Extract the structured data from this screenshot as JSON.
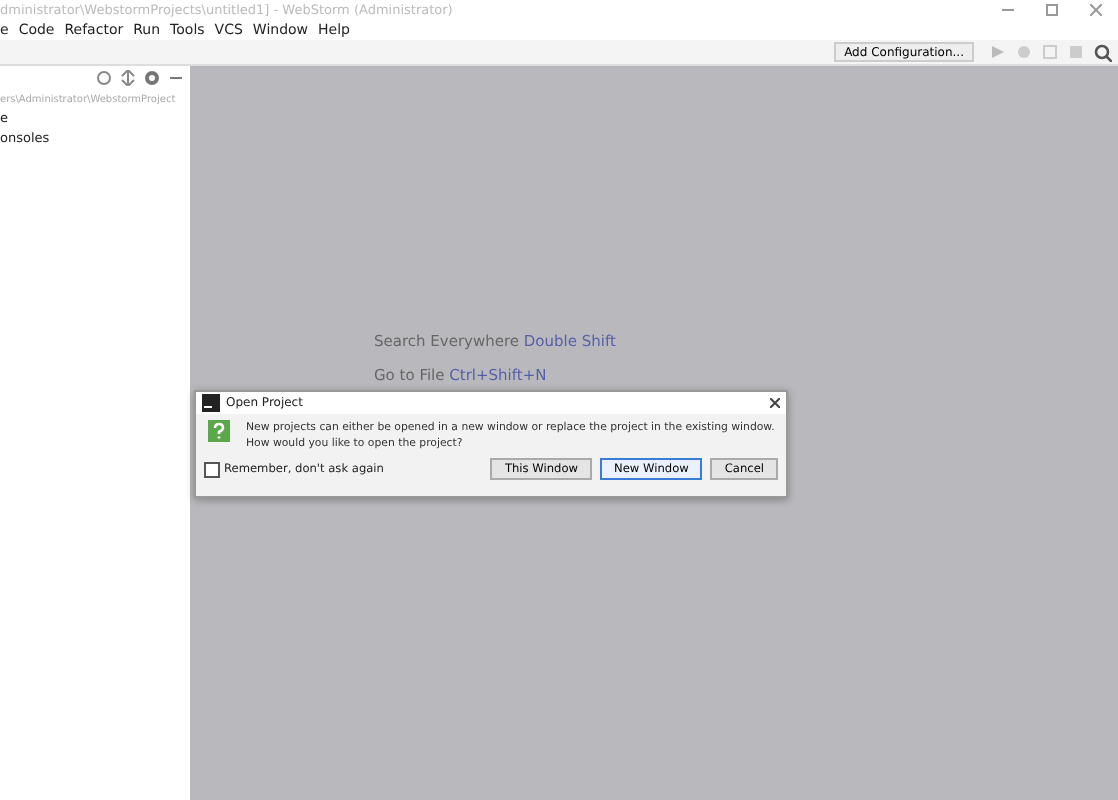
{
  "window": {
    "title": "dministrator\\WebstormProjects\\untitled1] - WebStorm (Administrator)"
  },
  "menu": [
    "e",
    "Code",
    "Refactor",
    "Run",
    "Tools",
    "VCS",
    "Window",
    "Help"
  ],
  "toolbar": {
    "config_button": "Add Configuration..."
  },
  "sidebar": {
    "path": "ers\\Administrator\\WebstormProject",
    "items": [
      "e",
      "onsoles"
    ]
  },
  "hints": [
    {
      "label": "Search Everywhere",
      "shortcut": "Double Shift"
    },
    {
      "label": "Go to File",
      "shortcut": "Ctrl+Shift+N"
    }
  ],
  "dialog": {
    "title": "Open Project",
    "message": "New projects can either be opened in a new window or replace the project in the existing window.\nHow would you like to open the project?",
    "checkbox": {
      "label": "Remember, don't ask again",
      "checked": false
    },
    "buttons": [
      {
        "label": "This Window",
        "selected": false
      },
      {
        "label": "New Window",
        "selected": true
      },
      {
        "label": "Cancel",
        "selected": false
      }
    ]
  }
}
